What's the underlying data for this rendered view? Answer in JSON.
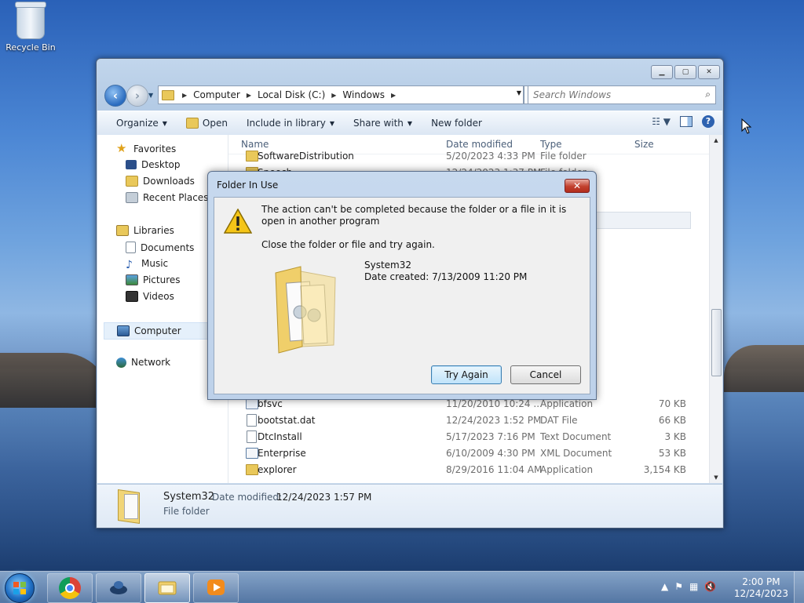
{
  "desktop": {
    "recycle_bin_label": "Recycle Bin"
  },
  "window": {
    "address": {
      "crumbs": [
        "Computer",
        "Local Disk (C:)",
        "Windows"
      ]
    },
    "search": {
      "placeholder": "Search Windows"
    },
    "toolbar": {
      "organize": "Organize",
      "open": "Open",
      "include_in_library": "Include in library",
      "share_with": "Share with",
      "new_folder": "New folder"
    },
    "nav": {
      "favorites": "Favorites",
      "desktop": "Desktop",
      "downloads": "Downloads",
      "recent_places": "Recent Places",
      "libraries": "Libraries",
      "documents": "Documents",
      "music": "Music",
      "pictures": "Pictures",
      "videos": "Videos",
      "computer": "Computer",
      "network": "Network"
    },
    "columns": {
      "name": "Name",
      "date": "Date modified",
      "type": "Type",
      "size": "Size"
    },
    "files": [
      {
        "name": "SoftwareDistribution",
        "date": "5/20/2023 4:33 PM",
        "type": "File folder",
        "size": ""
      },
      {
        "name": "Speech",
        "date": "12/24/2023 1:37 PM",
        "type": "File folder",
        "size": ""
      },
      {
        "name": "bfsvc",
        "date": "11/20/2010 10:24 ...",
        "type": "Application",
        "size": "70 KB"
      },
      {
        "name": "bootstat.dat",
        "date": "12/24/2023 1:52 PM",
        "type": "DAT File",
        "size": "66 KB"
      },
      {
        "name": "DtcInstall",
        "date": "5/17/2023 7:16 PM",
        "type": "Text Document",
        "size": "3 KB"
      },
      {
        "name": "Enterprise",
        "date": "6/10/2009 4:30 PM",
        "type": "XML Document",
        "size": "53 KB"
      },
      {
        "name": "explorer",
        "date": "8/29/2016 11:04 AM",
        "type": "Application",
        "size": "3,154 KB"
      }
    ],
    "details": {
      "name": "System32",
      "modified_label": "Date modified:",
      "modified_value": "12/24/2023 1:57 PM",
      "type": "File folder"
    }
  },
  "dialog": {
    "title": "Folder In Use",
    "message": "The action can't be completed because the folder or a file in it is open in another program",
    "instruction": "Close the folder or file and try again.",
    "item_name": "System32",
    "item_created": "Date created: 7/13/2009 11:20 PM",
    "try_again": "Try Again",
    "cancel": "Cancel"
  },
  "taskbar": {
    "time": "2:00 PM",
    "date": "12/24/2023",
    "apps": [
      "chrome-icon",
      "game-controller-icon",
      "explorer-folder-icon",
      "media-player-icon"
    ]
  }
}
